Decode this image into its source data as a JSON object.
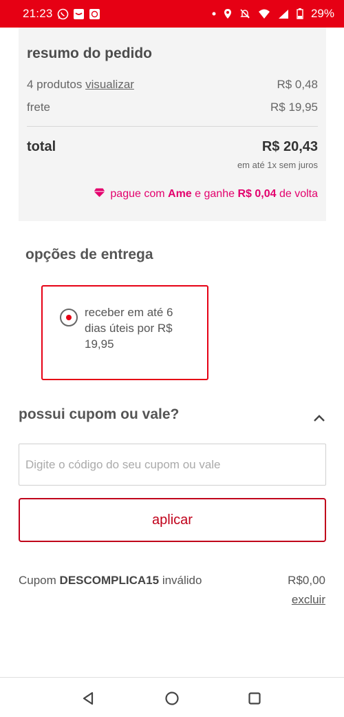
{
  "status_bar": {
    "time": "21:23",
    "battery": "29%",
    "icons": [
      "whatsapp-icon",
      "email-icon",
      "app-icon",
      "dot-icon",
      "location-icon",
      "mute-icon",
      "wifi-icon",
      "signal-icon",
      "battery-icon"
    ]
  },
  "summary": {
    "title": "resumo do pedido",
    "products_label": "4 produtos",
    "view_link": "visualizar",
    "products_value": "R$ 0,48",
    "shipping_label": "frete",
    "shipping_value": "R$ 19,95",
    "total_label": "total",
    "total_value": "R$ 20,43",
    "installments": "em até 1x sem juros",
    "ame": {
      "prefix": "pague com",
      "brand": "Ame",
      "middle": "e ganhe",
      "amount": "R$ 0,04",
      "suffix": "de volta"
    }
  },
  "delivery": {
    "title": "opções de entrega",
    "option_text": "receber em até 6 dias úteis por R$ 19,95"
  },
  "coupon": {
    "title": "possui cupom ou vale?",
    "placeholder": "Digite o código do seu cupom ou vale",
    "apply_label": "aplicar",
    "status_prefix": "Cupom",
    "code": "DESCOMPLICA15",
    "status_suffix": "inválido",
    "value": "R$0,00",
    "remove_label": "excluir"
  },
  "colors": {
    "brand_red": "#e60014",
    "ame_pink": "#e3006d",
    "card_bg": "#f4f4f4"
  }
}
